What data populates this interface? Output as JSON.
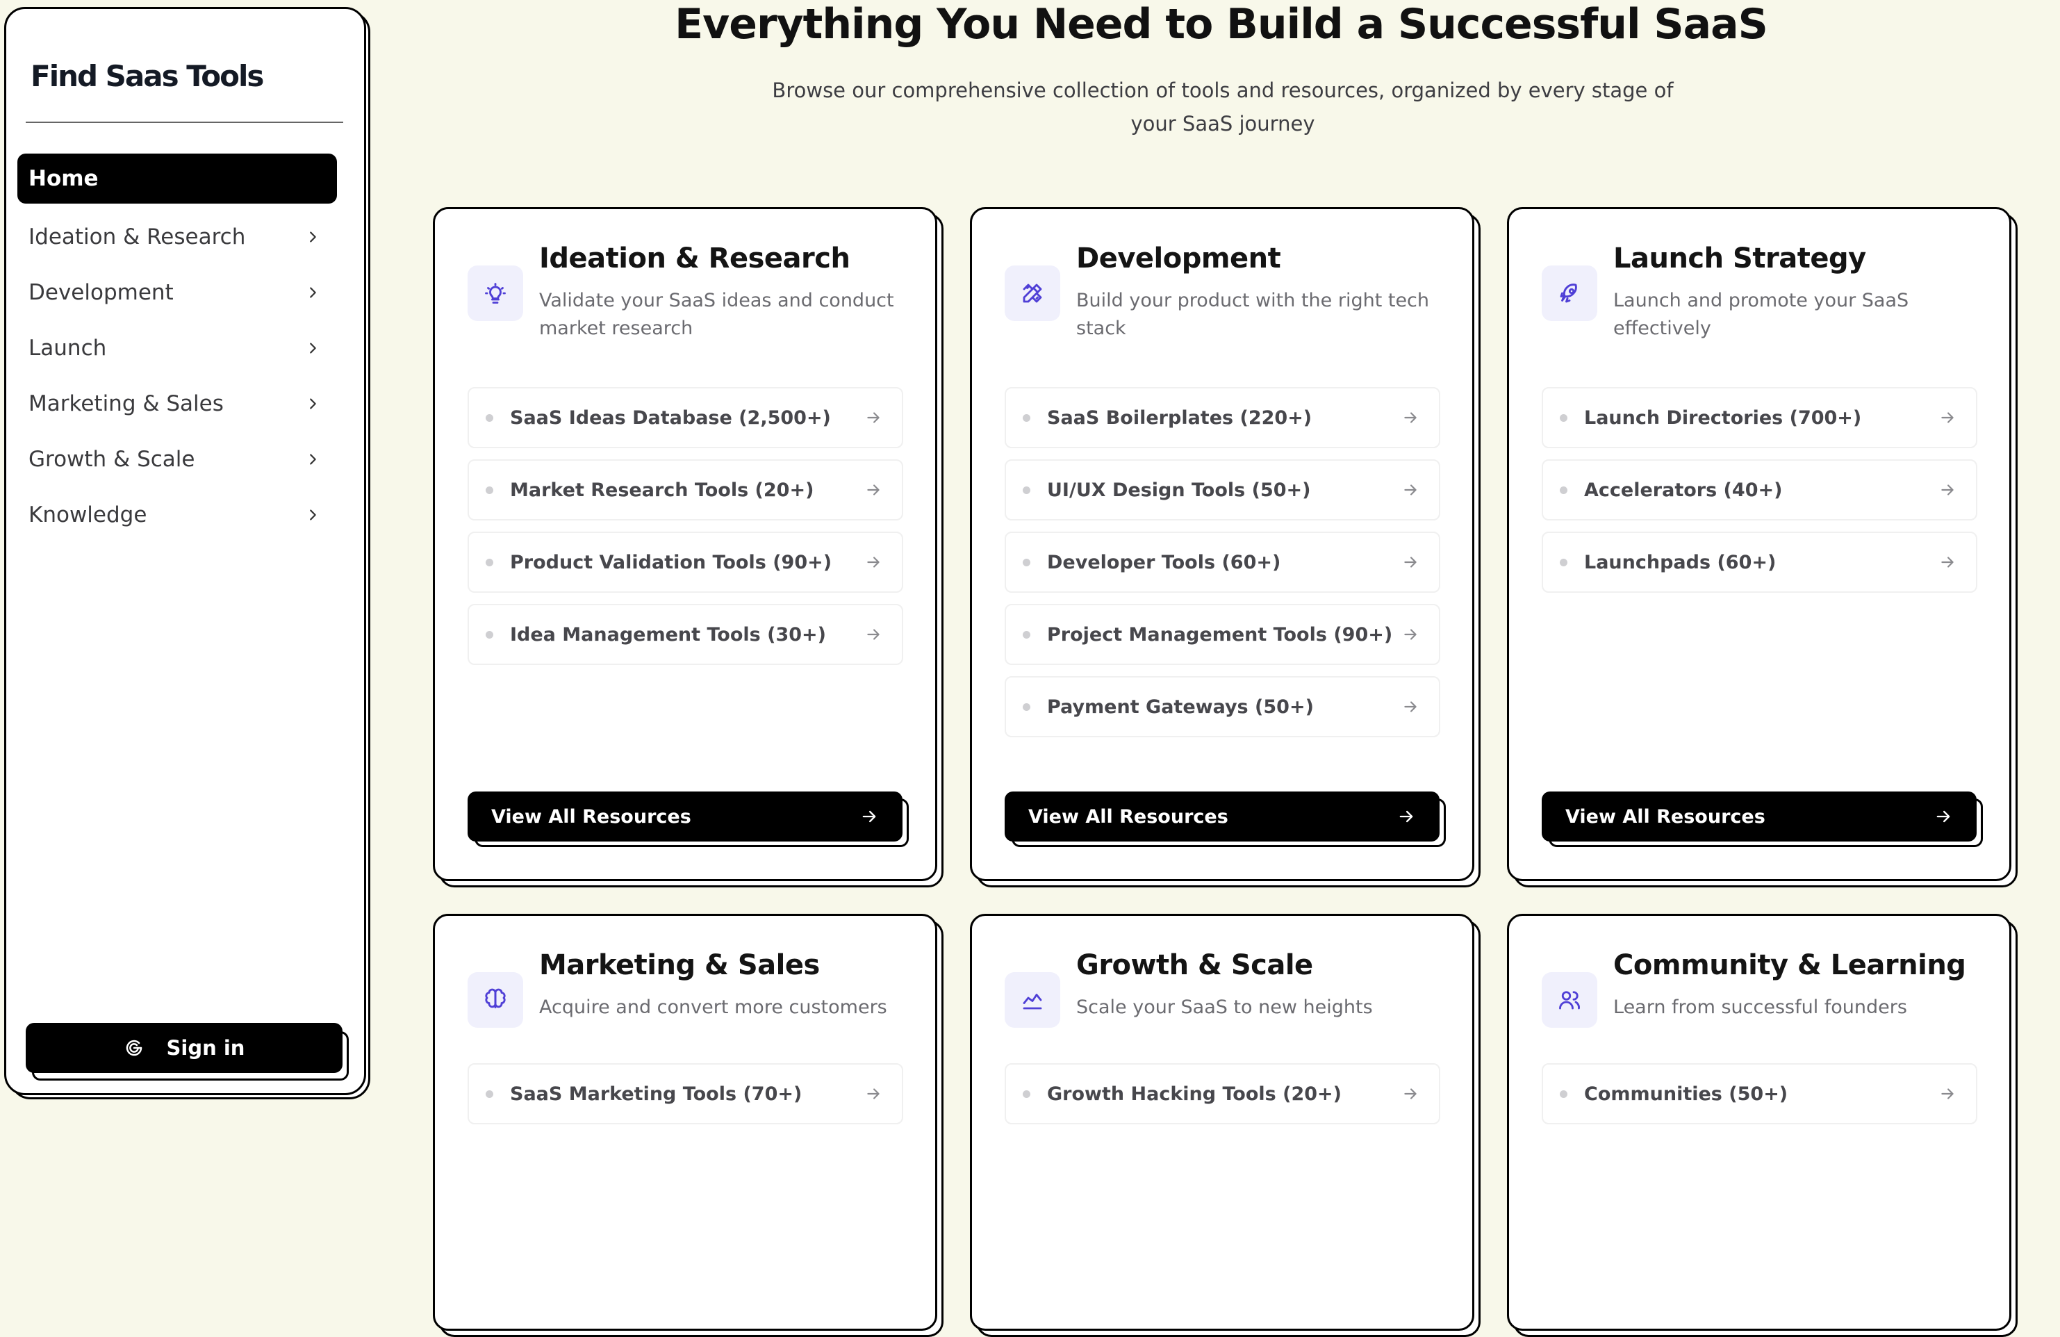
{
  "sidebar": {
    "logo": "Find Saas Tools",
    "active": "Home",
    "items": [
      {
        "label": "Ideation & Research"
      },
      {
        "label": "Development"
      },
      {
        "label": "Launch"
      },
      {
        "label": "Marketing & Sales"
      },
      {
        "label": "Growth & Scale"
      },
      {
        "label": "Knowledge"
      }
    ],
    "sign_in": "Sign in",
    "sign_in_icon": "google-icon"
  },
  "header": {
    "title": "Everything You Need to Build a Successful SaaS",
    "subtitle": "Browse our comprehensive collection of tools and resources, organized by every stage of your SaaS journey"
  },
  "colors": {
    "background": "#f8f8ea",
    "accent": "#4f3fd6",
    "icon_bg": "#f0f0fc",
    "button": "#000000"
  },
  "cards": [
    {
      "title": "Ideation & Research",
      "description": "Validate your SaaS ideas and conduct market research",
      "icon": "lightbulb-icon",
      "items": [
        "SaaS Ideas Database (2,500+)",
        "Market Research Tools (20+)",
        "Product Validation Tools (90+)",
        "Idea Management Tools (30+)"
      ],
      "button": "View All Resources"
    },
    {
      "title": "Development",
      "description": "Build your product with the right tech stack",
      "icon": "pencil-ruler-icon",
      "items": [
        "SaaS Boilerplates (220+)",
        "UI/UX Design Tools (50+)",
        "Developer Tools (60+)",
        "Project Management Tools (90+)",
        "Payment Gateways (50+)"
      ],
      "button": "View All Resources"
    },
    {
      "title": "Launch Strategy",
      "description": "Launch and promote your SaaS effectively",
      "icon": "rocket-icon",
      "items": [
        "Launch Directories (700+)",
        "Accelerators (40+)",
        "Launchpads (60+)"
      ],
      "button": "View All Resources"
    },
    {
      "title": "Marketing & Sales",
      "description": "Acquire and convert more customers",
      "icon": "brain-icon",
      "items": [
        "SaaS Marketing Tools (70+)"
      ]
    },
    {
      "title": "Growth & Scale",
      "description": "Scale your SaaS to new heights",
      "icon": "chart-line-icon",
      "items": [
        "Growth Hacking Tools (20+)"
      ]
    },
    {
      "title": "Community & Learning",
      "description": "Learn from successful founders",
      "icon": "users-icon",
      "items": [
        "Communities (50+)"
      ]
    }
  ]
}
